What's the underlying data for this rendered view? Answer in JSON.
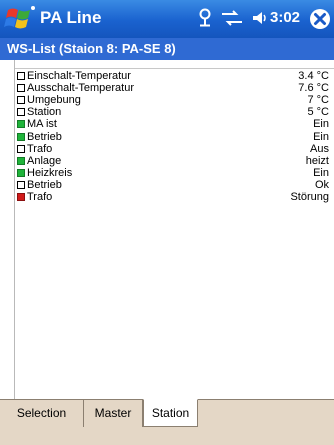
{
  "window": {
    "app_title": "PA Line",
    "clock": "3:02",
    "subtitle": "WS-List (Staion 8: PA-SE 8)"
  },
  "icons": [
    "windows-start-flag-icon",
    "connectivity-icon",
    "signal-icon",
    "volume-icon",
    "close-icon"
  ],
  "colors": {
    "titlebar": "#1a62cf",
    "subtitle_bar": "#2f6ad3",
    "status_green": "#1fb43a",
    "status_red": "#d11a1a",
    "status_empty": "#ffffff",
    "tab_strip": "#e4d7c6"
  },
  "rows": [
    {
      "label": "Einschalt-Temperatur",
      "value": "3.4 °C",
      "status": "empty"
    },
    {
      "label": "Ausschalt-Temperatur",
      "value": "7.6 °C",
      "status": "empty"
    },
    {
      "label": "Umgebung",
      "value": "7 °C",
      "status": "empty"
    },
    {
      "label": "Station",
      "value": "5 °C",
      "status": "empty"
    },
    {
      "label": "MA ist",
      "value": "Ein",
      "status": "green"
    },
    {
      "label": "Betrieb",
      "value": "Ein",
      "status": "green"
    },
    {
      "label": "Trafo",
      "value": "Aus",
      "status": "empty"
    },
    {
      "label": "Anlage",
      "value": "heizt",
      "status": "green"
    },
    {
      "label": "Heizkreis",
      "value": "Ein",
      "status": "green"
    },
    {
      "label": "Betrieb",
      "value": "Ok",
      "status": "empty"
    },
    {
      "label": "Trafo",
      "value": "Störung",
      "status": "red"
    }
  ],
  "tabs": [
    {
      "label": "Selection",
      "active": false
    },
    {
      "label": "Master",
      "active": false
    },
    {
      "label": "Station",
      "active": true
    }
  ]
}
